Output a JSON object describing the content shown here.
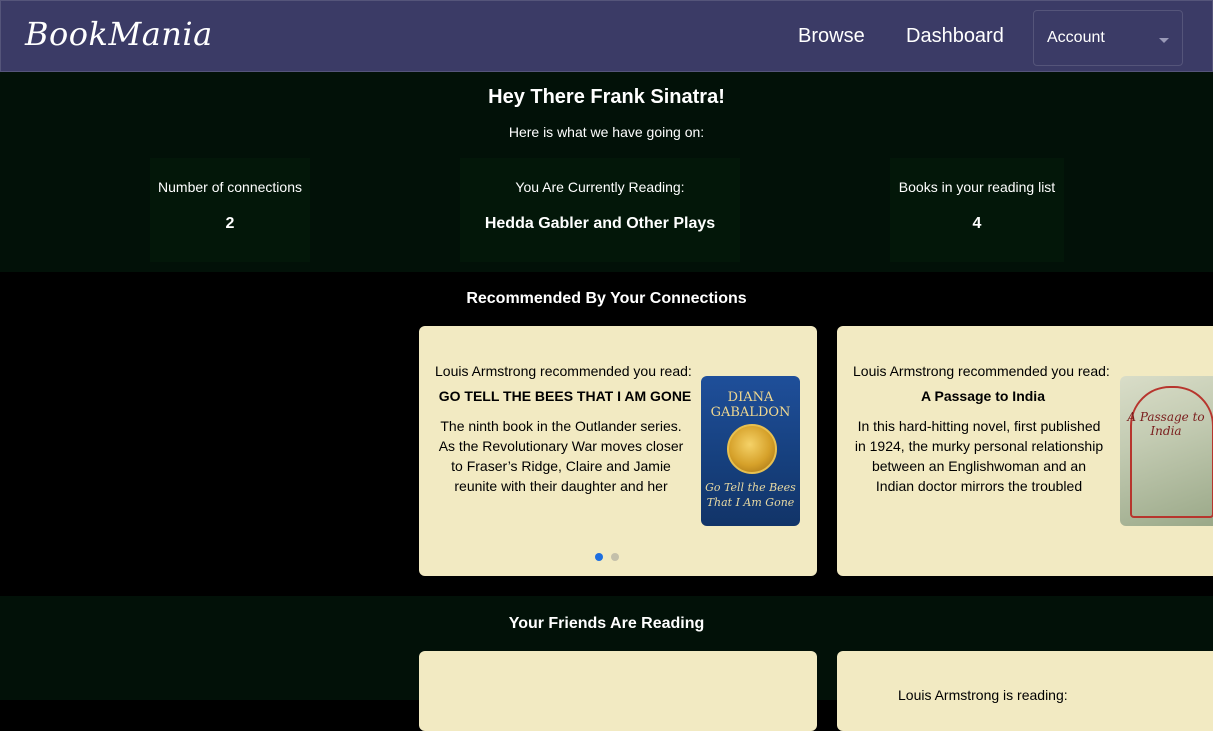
{
  "nav": {
    "brand": "BookMania",
    "browse": "Browse",
    "dashboard": "Dashboard",
    "account": "Account"
  },
  "dashboard": {
    "greeting": "Hey There Frank Sinatra!",
    "subgreeting": "Here is what we have going on:",
    "stats": {
      "connections_label": "Number of connections",
      "connections_value": "2",
      "reading_label": "You Are Currently Reading:",
      "reading_value": "Hedda Gabler and Other Plays",
      "list_label": "Books in your reading list",
      "list_value": "4"
    }
  },
  "recommended": {
    "title": "Recommended By Your Connections",
    "cards": [
      {
        "header": "Louis Armstrong recommended you read:",
        "book_title": "GO TELL THE BEES THAT I AM GONE",
        "description": "The ninth book in the Outlander series. As the Revolutionary War moves closer to Fraser’s Ridge, Claire and Jamie reunite with their daughter and her",
        "cover": {
          "author": "DIANA GABALDON",
          "subtitle": "Go Tell the Bees That I Am Gone"
        }
      },
      {
        "header": "Louis Armstrong recommended you read:",
        "book_title": "A Passage to India",
        "description": "In this hard-hitting novel, first published in 1924, the murky personal relationship between an Englishwoman and an Indian doctor mirrors the troubled",
        "cover": {
          "title": "A Passage to India"
        }
      }
    ],
    "carousel_pages": 2,
    "carousel_active": 1
  },
  "friends": {
    "title": "Your Friends Are Reading",
    "cards": [
      {
        "header": ""
      },
      {
        "header": "Louis Armstrong is reading:"
      }
    ]
  },
  "colors": {
    "navbar": "#3b3b66",
    "card": "#f2eac2",
    "dot_active": "#1e6fe0"
  }
}
